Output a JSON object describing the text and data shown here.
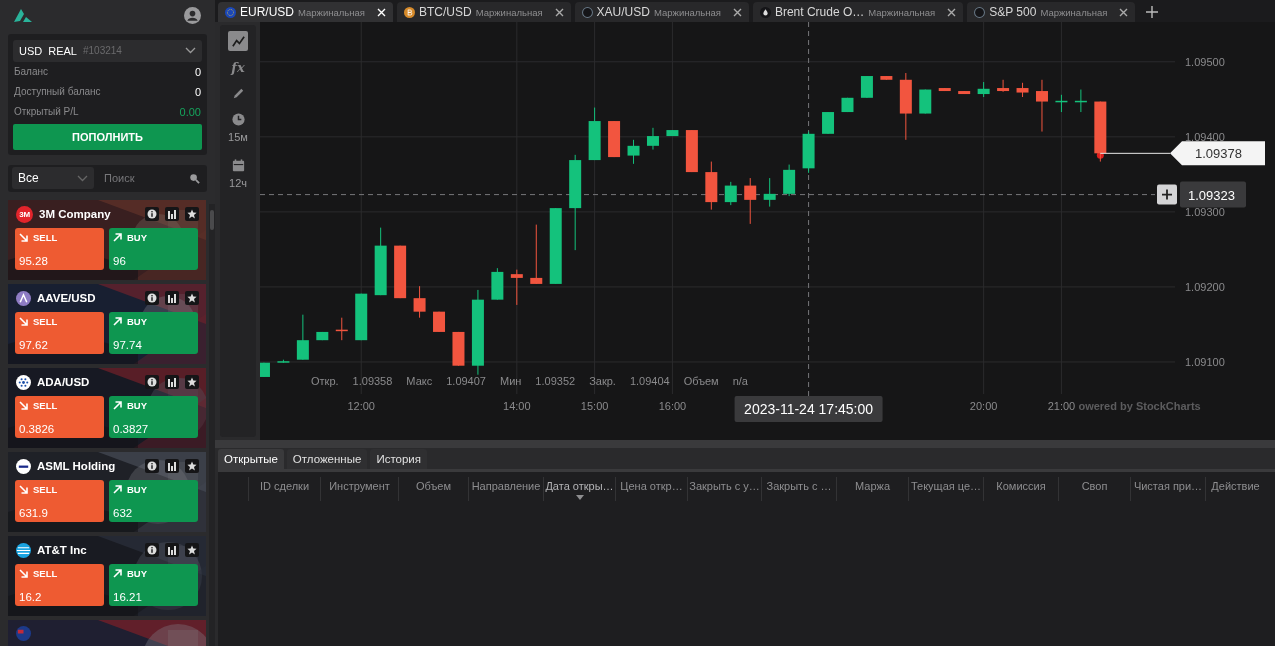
{
  "sidebar": {
    "account": {
      "currency": "USD",
      "type": "REAL",
      "number": "#103214",
      "rows": [
        {
          "label": "Баланс",
          "value": "0",
          "kind": "plain"
        },
        {
          "label": "Доступный баланс",
          "value": "0",
          "kind": "plain"
        },
        {
          "label": "Открытый P/L",
          "value": "0.00",
          "kind": "profit"
        }
      ],
      "deposit_button": "ПОПОЛНИТЬ"
    },
    "filter": {
      "value": "Все",
      "search_placeholder": "Поиск"
    },
    "instruments": [
      {
        "name": "3M Company",
        "kind": "text-logo",
        "logo_text": "3M",
        "sell": {
          "label": "SELL",
          "price": "95.28"
        },
        "buy": {
          "label": "BUY",
          "price": "96"
        }
      },
      {
        "name": "AAVE/USD",
        "kind": "triangle",
        "sell": {
          "label": "SELL",
          "price": "97.62"
        },
        "buy": {
          "label": "BUY",
          "price": "97.74"
        }
      },
      {
        "name": "ADA/USD",
        "kind": "dots",
        "sell": {
          "label": "SELL",
          "price": "0.3826"
        },
        "buy": {
          "label": "BUY",
          "price": "0.3827"
        }
      },
      {
        "name": "ASML Holding",
        "kind": "bar",
        "sell": {
          "label": "SELL",
          "price": "631.9"
        },
        "buy": {
          "label": "BUY",
          "price": "632"
        }
      },
      {
        "name": "AT&T Inc",
        "kind": "globe",
        "sell": {
          "label": "SELL",
          "price": "16.2"
        },
        "buy": {
          "label": "BUY",
          "price": "16.21"
        }
      },
      {
        "kind": "flag"
      }
    ]
  },
  "tabs": [
    {
      "symbol": "EUR/USD",
      "subtitle": "Маржинальная",
      "kind": "stars",
      "selected": true
    },
    {
      "symbol": "BTC/USD",
      "subtitle": "Маржинальная",
      "kind": "coin",
      "selected": false
    },
    {
      "symbol": "XAU/USD",
      "subtitle": "Маржинальная",
      "kind": "ring",
      "selected": false
    },
    {
      "symbol": "Brent Crude O…",
      "subtitle": "Маржинальная",
      "kind": "drop",
      "selected": false
    },
    {
      "symbol": "S&P 500",
      "subtitle": "Маржинальная",
      "kind": "ring",
      "selected": false
    }
  ],
  "toolbar": [
    {
      "kind": "line",
      "selected": true
    },
    {
      "kind": "function",
      "glyph": "fx",
      "selected": false
    },
    {
      "kind": "pencil",
      "selected": false
    },
    {
      "kind": "clock",
      "label": "15м",
      "selected": false
    },
    {
      "kind": "calendar",
      "label": "12ч",
      "selected": false
    }
  ],
  "chart": {
    "chart_data": {
      "type": "candlestick",
      "x": [
        10.75,
        11,
        11.25,
        11.5,
        11.75,
        12,
        12.25,
        12.5,
        12.75,
        13,
        13.25,
        13.5,
        13.75,
        14,
        14.25,
        14.5,
        14.75,
        15,
        15.25,
        15.5,
        15.75,
        16,
        16.25,
        16.5,
        16.75,
        17,
        17.25,
        17.5,
        17.75,
        18,
        18.25,
        18.5,
        18.75,
        19,
        19.25,
        19.5,
        19.75,
        20,
        20.25,
        20.5,
        20.75,
        21,
        21.25,
        21.5
      ],
      "ohlc": [
        [
          1.0908,
          1.09099,
          1.0908,
          1.09099
        ],
        [
          1.09099,
          1.09103,
          1.09099,
          1.09101
        ],
        [
          1.09103,
          1.09163,
          1.09103,
          1.09129
        ],
        [
          1.09129,
          1.0914,
          1.09129,
          1.0914
        ],
        [
          1.09143,
          1.09159,
          1.09129,
          1.09142
        ],
        [
          1.09129,
          1.09191,
          1.09129,
          1.09191
        ],
        [
          1.09189,
          1.09279,
          1.09189,
          1.09255
        ],
        [
          1.09255,
          1.09255,
          1.09185,
          1.09185
        ],
        [
          1.09185,
          1.09201,
          1.09159,
          1.09167
        ],
        [
          1.09167,
          1.09167,
          1.0914,
          1.0914
        ],
        [
          1.0914,
          1.0914,
          1.09095,
          1.09095
        ],
        [
          1.09095,
          1.09196,
          1.09083,
          1.09183
        ],
        [
          1.09183,
          1.09225,
          1.09183,
          1.0922
        ],
        [
          1.09217,
          1.09223,
          1.09176,
          1.09212
        ],
        [
          1.09212,
          1.09283,
          1.09204,
          1.09204
        ],
        [
          1.09204,
          1.09305,
          1.09204,
          1.09305
        ],
        [
          1.09305,
          1.09376,
          1.09249,
          1.09369
        ],
        [
          1.09369,
          1.09439,
          1.09369,
          1.09421
        ],
        [
          1.09421,
          1.09421,
          1.09373,
          1.09373
        ],
        [
          1.09375,
          1.09396,
          1.09364,
          1.09388
        ],
        [
          1.09388,
          1.09412,
          1.09383,
          1.09401
        ],
        [
          1.09401,
          1.09409,
          1.09401,
          1.09409
        ],
        [
          1.09409,
          1.09409,
          1.09353,
          1.09353
        ],
        [
          1.09353,
          1.09367,
          1.09303,
          1.09313
        ],
        [
          1.09313,
          1.0934,
          1.09309,
          1.09335
        ],
        [
          1.09335,
          1.09345,
          1.09284,
          1.09316
        ],
        [
          1.09316,
          1.09345,
          1.09307,
          1.09324
        ],
        [
          1.09324,
          1.09363,
          1.09321,
          1.09356
        ],
        [
          1.09358,
          1.09407,
          1.09352,
          1.09404
        ],
        [
          1.09404,
          1.09433,
          1.09404,
          1.09433
        ],
        [
          1.09433,
          1.09452,
          1.09433,
          1.09452
        ],
        [
          1.09452,
          1.09481,
          1.09452,
          1.09481
        ],
        [
          1.09481,
          1.09481,
          1.09476,
          1.09476
        ],
        [
          1.09476,
          1.09485,
          1.09396,
          1.09431
        ],
        [
          1.09431,
          1.09463,
          1.09431,
          1.09463
        ],
        [
          1.09465,
          1.09465,
          1.09461,
          1.09461
        ],
        [
          1.09461,
          1.09461,
          1.09457,
          1.09457
        ],
        [
          1.09457,
          1.09473,
          1.09453,
          1.09464
        ],
        [
          1.09465,
          1.09476,
          1.0946,
          1.09461
        ],
        [
          1.09465,
          1.09472,
          1.09453,
          1.09459
        ],
        [
          1.09461,
          1.09476,
          1.09407,
          1.09447
        ],
        [
          1.09447,
          1.09456,
          1.09433,
          1.09448
        ],
        [
          1.09447,
          1.09463,
          1.09433,
          1.09448
        ],
        [
          1.09447,
          1.09447,
          1.09367,
          1.09378
        ]
      ],
      "xlim": [
        10.699,
        23.745
      ],
      "ylim": [
        1.08996,
        1.09553
      ],
      "xticks": [
        {
          "value": 12,
          "label": "12:00"
        },
        {
          "value": 14,
          "label": "14:00"
        },
        {
          "value": 15,
          "label": "15:00"
        },
        {
          "value": 16,
          "label": "16:00"
        },
        {
          "value": 20,
          "label": "20:00"
        },
        {
          "value": 21,
          "label": "21:00"
        }
      ],
      "yticks": [
        {
          "value": 1.091,
          "label": "1.09100"
        },
        {
          "value": 1.092,
          "label": "1.09200"
        },
        {
          "value": 1.093,
          "label": "1.09300"
        },
        {
          "value": 1.094,
          "label": "1.09400"
        },
        {
          "value": 1.095,
          "label": "1.09500"
        }
      ],
      "grid": true,
      "ref_lines": [
        {
          "axis": "x",
          "value": 17.75
        },
        {
          "axis": "y",
          "value": 1.09323
        }
      ]
    },
    "price_label": "1.09378",
    "crosshair": {
      "price": "1.09323",
      "time": "2023-11-24 17:45:00"
    },
    "ohlc_readout": [
      {
        "label": "Откр.",
        "value": "1.09358"
      },
      {
        "label": "Макс",
        "value": "1.09407"
      },
      {
        "label": "Мин",
        "value": "1.09352"
      },
      {
        "label": "Закр.",
        "value": "1.09404"
      },
      {
        "label": "Объем",
        "value": "n/a"
      }
    ],
    "attribution": "owered by StockCharts"
  },
  "positions": {
    "tabs": [
      {
        "label": "Открытые",
        "selected": true
      },
      {
        "label": "Отложенные",
        "selected": false
      },
      {
        "label": "История",
        "selected": false
      }
    ],
    "columns": [
      {
        "label": "ID сделки",
        "sorted": false
      },
      {
        "label": "Инструмент",
        "sorted": false
      },
      {
        "label": "Объем",
        "sorted": false
      },
      {
        "label": "Направление",
        "sorted": false
      },
      {
        "label": "Дата откры…",
        "sorted": true
      },
      {
        "label": "Цена откр…",
        "sorted": false
      },
      {
        "label": "Закрыть с у…",
        "sorted": false
      },
      {
        "label": "Закрыть с …",
        "sorted": false
      },
      {
        "label": "Маржа",
        "sorted": false
      },
      {
        "label": "Текущая це…",
        "sorted": false
      },
      {
        "label": "Комиссия",
        "sorted": false
      },
      {
        "label": "Своп",
        "sorted": false
      },
      {
        "label": "Чистая при…",
        "sorted": false
      },
      {
        "label": "Действие",
        "sorted": false
      }
    ]
  }
}
